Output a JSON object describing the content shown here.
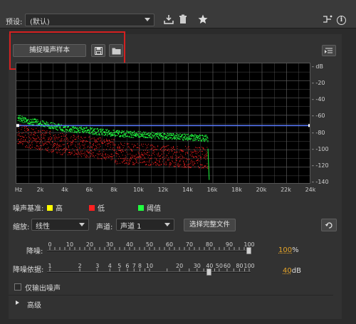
{
  "toolbar": {
    "preset_label": "预设:",
    "preset_value": "(默认)",
    "icons": [
      "save-preset-icon",
      "delete-icon",
      "favorite-star-icon",
      "routing-icon",
      "info-icon"
    ]
  },
  "capture": {
    "button_label": "捕捉噪声样本",
    "save_icon": "save-icon",
    "open_icon": "folder-icon"
  },
  "graph": {
    "db_ticks": [
      "dB",
      "-20",
      "-40",
      "-60",
      "-80",
      "-100",
      "-120",
      "-140"
    ],
    "freq_ticks": [
      "Hz",
      "2k",
      "4k",
      "6k",
      "8k",
      "10k",
      "12k",
      "14k",
      "16k",
      "18k",
      "20k",
      "22k",
      "24k"
    ],
    "colors": {
      "high": "#ffff00",
      "low": "#ff2020",
      "threshold": "#20ff40",
      "curve": "#5a7cff",
      "grid": "#5a5a5a"
    }
  },
  "legend": {
    "title": "噪声基准:",
    "high": "高",
    "low": "低",
    "threshold": "阈值"
  },
  "controls": {
    "scale_label": "缩放:",
    "scale_value": "线性",
    "channel_label": "声道:",
    "channel_value": "声道 1",
    "select_full_button": "选择完整文件"
  },
  "noise_reduction": {
    "label": "降噪:",
    "scale": [
      "0",
      "10",
      "20",
      "30",
      "40",
      "50",
      "60",
      "70",
      "80",
      "90",
      "100"
    ],
    "value": "100",
    "unit": "%"
  },
  "reduce_by": {
    "label": "降噪依据:",
    "scale": [
      "1",
      "2",
      "3",
      "4",
      "5",
      "6",
      "7",
      "8",
      "10",
      "20",
      "30",
      "40",
      "50",
      "60",
      "80",
      "100"
    ],
    "value": "40",
    "unit": "dB"
  },
  "output_noise_only": "仅输出噪声",
  "advanced": "高级"
}
